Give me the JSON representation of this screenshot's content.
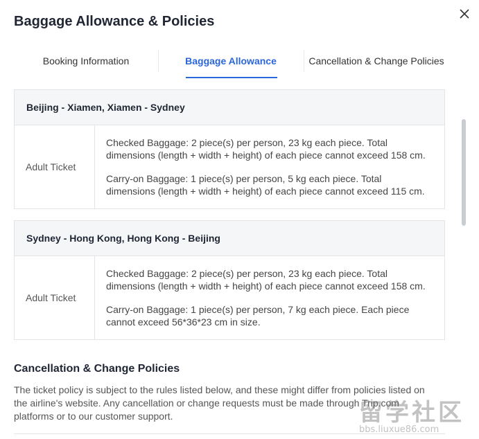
{
  "dialog": {
    "title": "Baggage Allowance & Policies",
    "close_icon": "close-icon"
  },
  "tabs": [
    {
      "label": "Booking Information",
      "active": false
    },
    {
      "label": "Baggage Allowance",
      "active": true
    },
    {
      "label": "Cancellation & Change Policies",
      "active": false
    }
  ],
  "colors": {
    "accent": "#2b66d9",
    "border": "#e2e4e8",
    "header_bg": "#f5f6f8"
  },
  "segments": [
    {
      "route": "Beijing - Xiamen, Xiamen - Sydney",
      "ticket_type": "Adult Ticket",
      "checked": "Checked Baggage: 2 piece(s) per person, 23 kg each piece. Total dimensions (length + width + height) of each piece cannot exceed 158 cm.",
      "carry_on": "Carry-on Baggage: 1 piece(s) per person, 5 kg each piece. Total dimensions (length + width + height) of each piece cannot exceed 115 cm."
    },
    {
      "route": "Sydney - Hong Kong, Hong Kong - Beijing",
      "ticket_type": "Adult Ticket",
      "checked": "Checked Baggage: 2 piece(s) per person, 23 kg each piece. Total dimensions (length + width + height) of each piece cannot exceed 158 cm.",
      "carry_on": "Carry-on Baggage: 1 piece(s) per person, 7 kg each piece. Each piece cannot exceed 56*36*23 cm in size."
    }
  ],
  "policies": {
    "title": "Cancellation & Change Policies",
    "body": "The ticket policy is subject to the rules listed below, and these might differ from policies listed on the airline's website. Any cancellation or change requests must be made through Trip.com platforms or to our customer support."
  },
  "watermark": {
    "text": "留学社区",
    "url": "bbs.liuxue86.com"
  }
}
